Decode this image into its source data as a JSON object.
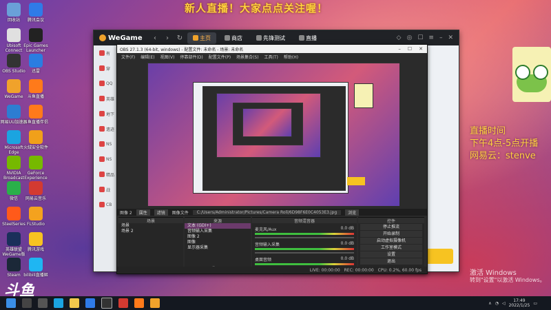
{
  "banner": "新人直播！大家点点关注喔！",
  "right_info": {
    "line1": "直播时间",
    "line2": "下午4点-5点开播",
    "line3": "网易云：stenve"
  },
  "watermark_logo": "斗鱼",
  "windows_watermark": {
    "title": "激活 Windows",
    "sub": "转到\"设置\"以激活 Windows。"
  },
  "desktop_icons": [
    {
      "label": "回收站",
      "color": "#6aa0d8"
    },
    {
      "label": "腾讯会议",
      "color": "#2f7be8"
    },
    {
      "label": "Ubisoft Connect",
      "color": "#e0e0e0"
    },
    {
      "label": "Epic Games Launcher",
      "color": "#222222"
    },
    {
      "label": "OBS Studio",
      "color": "#333333"
    },
    {
      "label": "迅雷",
      "color": "#2a7de1"
    },
    {
      "label": "WeGame",
      "color": "#f0a22b"
    },
    {
      "label": "斗鱼直播",
      "color": "#ff7a1a"
    },
    {
      "label": "网易UU加速器",
      "color": "#2d7dd2"
    },
    {
      "label": "斗鱼直播伴侣",
      "color": "#ff7a1a"
    },
    {
      "label": "Microsoft Edge",
      "color": "#1ba4e0"
    },
    {
      "label": "火绒安全软件",
      "color": "#f0a01a"
    },
    {
      "label": "NVIDIA Broadcast",
      "color": "#76b900"
    },
    {
      "label": "GeForce Experience",
      "color": "#76b900"
    },
    {
      "label": "微信",
      "color": "#2ab04a"
    },
    {
      "label": "网易云音乐",
      "color": "#d33a31"
    },
    {
      "label": "SteelSeries",
      "color": "#ff5a1a"
    },
    {
      "label": "FLStudio",
      "color": "#f4a21e"
    },
    {
      "label": "英雄联盟WeGame版",
      "color": "#1a2f5a"
    },
    {
      "label": "腾讯游戏",
      "color": "#f7c321"
    },
    {
      "label": "Steam",
      "color": "#1b2838"
    },
    {
      "label": "bilibili直播姬",
      "color": "#1fb6f2"
    }
  ],
  "wegame": {
    "logo": "WeGame",
    "tabs": [
      {
        "label": "主页",
        "active": true
      },
      {
        "label": "商店",
        "active": false
      },
      {
        "label": "先锋测试",
        "active": false
      },
      {
        "label": "直播",
        "active": false
      }
    ],
    "sidebar": [
      "有",
      "穿",
      "QQ",
      "英雄",
      "地下",
      "遗迹",
      "NS",
      "NS",
      "精品",
      "战",
      "CB"
    ]
  },
  "obs": {
    "title": "OBS 27.1.3 (64-bit, windows) - 配置文件: 未命名 - 场景: 未命名",
    "menu": [
      "文件(F)",
      "编辑(E)",
      "视图(V)",
      "停靠部件(D)",
      "配置文件(P)",
      "场景集合(S)",
      "工具(T)",
      "帮助(H)"
    ],
    "source_bar": {
      "label": "图像 2",
      "prop": "属性",
      "filter": "滤镜",
      "img_file": "图像文件",
      "path": "C:/Users/Administrator/Pictures/Camera Roll/6D98F6E0C4053E3.jpg",
      "browse": "浏览"
    },
    "docks": {
      "scenes_title": "场景",
      "scenes": [
        "场景",
        "场景 2"
      ],
      "sources_title": "来源",
      "sources": [
        "文本 (GDI+)",
        "音频输入采集",
        "图像 2",
        "图像",
        "显示器采集"
      ],
      "mixer_title": "音频混音器",
      "mixer": [
        {
          "name": "麦克风/Aux",
          "db": "0.0 dB"
        },
        {
          "name": "音频输入采集",
          "db": "0.0 dB"
        },
        {
          "name": "桌面音频",
          "db": "0.0 dB"
        }
      ],
      "controls_title": "控件",
      "controls": [
        "停止推流",
        "开始录制",
        "启动虚拟摄像机",
        "工作室模式",
        "设置",
        "退出"
      ]
    },
    "status": {
      "live": "LIVE: 00:00:00",
      "rec": "REC: 00:00:00",
      "cpu": "CPU: 0.2%, 60.00 fps"
    }
  },
  "taskbar": {
    "time": "17:49",
    "date": "2022/1/25"
  }
}
